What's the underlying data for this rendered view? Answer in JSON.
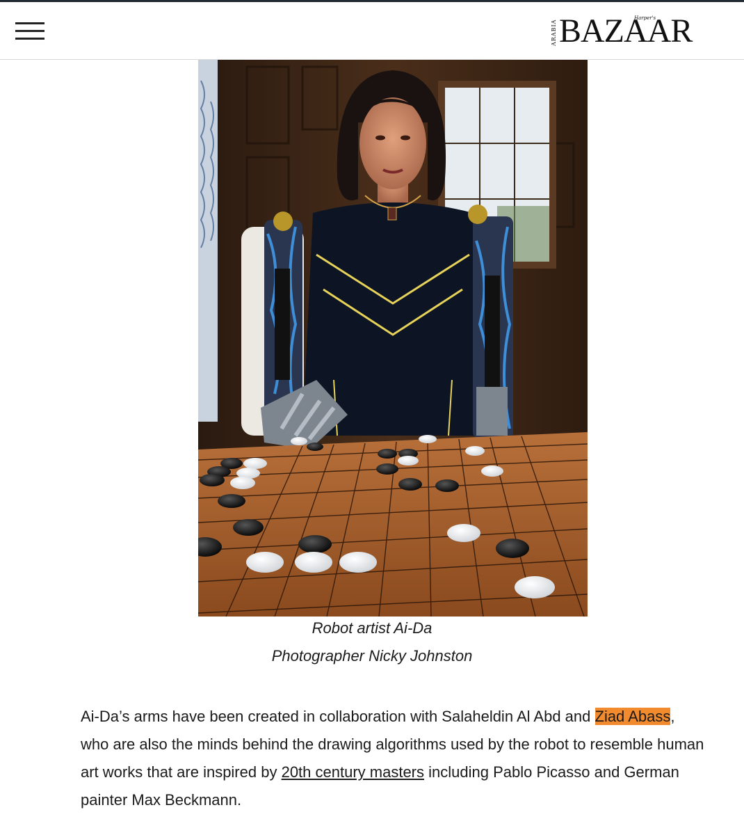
{
  "header": {
    "logo": {
      "wordmark": "BAZAAR",
      "small_top": "Harper's",
      "vertical_side": "ARABIA"
    },
    "menu_icon": "hamburger-icon"
  },
  "photo": {
    "alt": "Robot artist Ai-Da"
  },
  "caption": {
    "line1": "Robot artist Ai-Da",
    "line2": "Photographer Nicky Johnston"
  },
  "article": {
    "paragraph": {
      "part1": "Ai-Da’s arms have been created in collaboration with Salaheldin Al Abd and ",
      "highlight": "Ziad Abass",
      "part2": ", who are also the minds behind the drawing algorithms used by the robot to resemble human art works that are inspired by ",
      "link": "20th century masters",
      "part3": " including Pablo Picasso and German painter Max Beckmann."
    }
  },
  "colors": {
    "highlight": "#f28b2e",
    "header_line": "#1f2a33",
    "text": "#1a1a1a"
  }
}
